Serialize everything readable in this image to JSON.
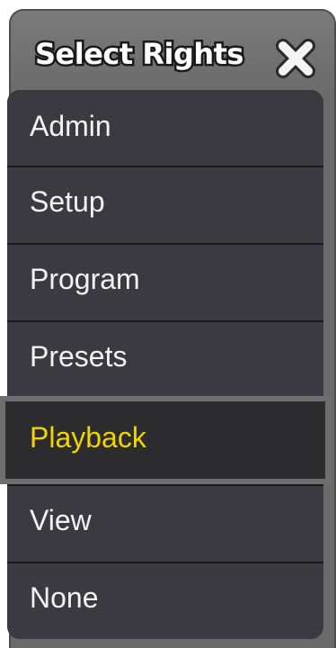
{
  "dialog": {
    "title": "Select Rights",
    "close_icon": "close-icon"
  },
  "options": [
    {
      "label": "Admin",
      "selected": false
    },
    {
      "label": "Setup",
      "selected": false
    },
    {
      "label": "Program",
      "selected": false
    },
    {
      "label": "Presets",
      "selected": false
    },
    {
      "label": "Playback",
      "selected": true
    },
    {
      "label": "View",
      "selected": false
    },
    {
      "label": "None",
      "selected": false
    }
  ],
  "colors": {
    "title_bar": "#6a6a6a",
    "item_background": "#3a3a40",
    "item_text": "#f2f2f2",
    "selected_text": "#f2d400",
    "selected_border": "#6e6e6e"
  }
}
